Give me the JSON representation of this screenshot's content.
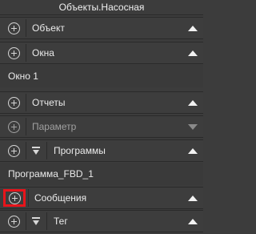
{
  "panel_title": "Объекты.Насосная",
  "sections": {
    "object": {
      "label": "Объект"
    },
    "windows": {
      "label": "Окна",
      "items": [
        "Окно 1"
      ]
    },
    "reports": {
      "label": "Отчеты"
    },
    "parameter": {
      "label": "Параметр"
    },
    "programs": {
      "label": "Программы",
      "items": [
        "Программа_FBD_1"
      ]
    },
    "messages": {
      "label": "Сообщения"
    },
    "tag": {
      "label": "Тег"
    }
  },
  "highlight_color": "#e8141b"
}
